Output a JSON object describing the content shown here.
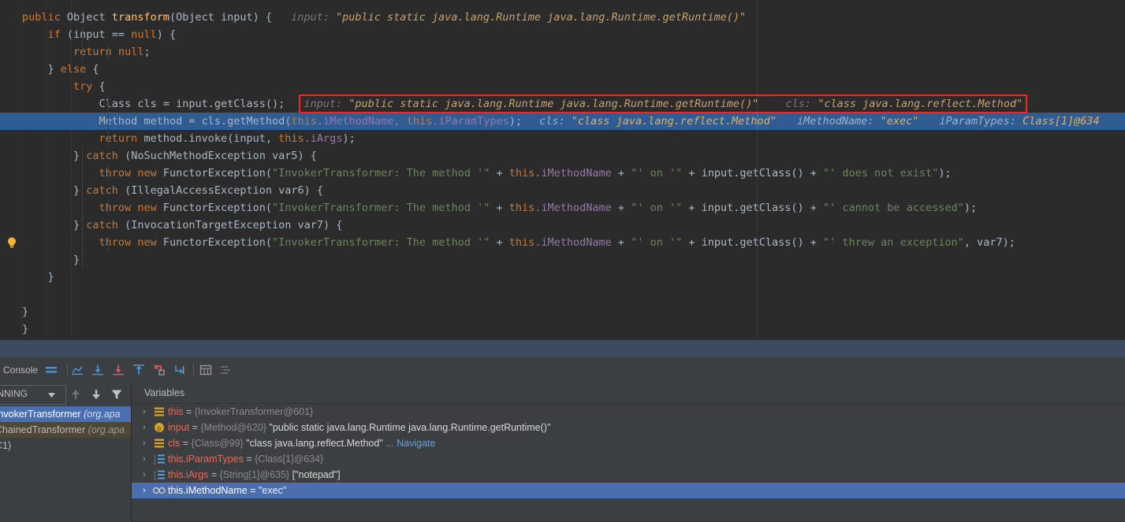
{
  "editor": {
    "code_lines": [
      {
        "indent": 0,
        "segments": [
          {
            "t": "public ",
            "c": "kw"
          },
          {
            "t": "Object ",
            "c": "id"
          },
          {
            "t": "transform",
            "c": "fn"
          },
          {
            "t": "(",
            "c": "id"
          },
          {
            "t": "Object ",
            "c": "id"
          },
          {
            "t": "input",
            "c": "id"
          },
          {
            "t": ") {",
            "c": "id"
          }
        ],
        "hints": [
          {
            "label": "input: ",
            "value": "\"public static java.lang.Runtime java.lang.Runtime.getRuntime()\"",
            "gap": 24
          }
        ]
      },
      {
        "indent": 1,
        "segments": [
          {
            "t": "if ",
            "c": "kw"
          },
          {
            "t": "(input == ",
            "c": "id"
          },
          {
            "t": "null",
            "c": "kw"
          },
          {
            "t": ") {",
            "c": "id"
          }
        ],
        "hints": []
      },
      {
        "indent": 2,
        "segments": [
          {
            "t": "return ",
            "c": "kw"
          },
          {
            "t": "null",
            "c": "kw"
          },
          {
            "t": ";",
            "c": "id"
          }
        ],
        "hints": []
      },
      {
        "indent": 1,
        "segments": [
          {
            "t": "} ",
            "c": "id"
          },
          {
            "t": "else",
            "c": "kw"
          },
          {
            "t": " {",
            "c": "id"
          }
        ],
        "hints": []
      },
      {
        "indent": 2,
        "segments": [
          {
            "t": "try",
            "c": "kw"
          },
          {
            "t": " {",
            "c": "id"
          }
        ],
        "hints": []
      },
      {
        "indent": 3,
        "segments": [
          {
            "t": "Class cls = input.getClass();",
            "c": "id"
          }
        ],
        "hints": [
          {
            "label": "input: ",
            "value": "\"public static java.lang.Runtime java.lang.Runtime.getRuntime()\"",
            "gap": 24
          },
          {
            "label": "cls: ",
            "value": "\"class java.lang.reflect.Method\"",
            "gap": 34
          }
        ]
      },
      {
        "indent": 3,
        "exec": true,
        "segments": [
          {
            "t": "Method method = cls.getMethod(",
            "c": "id"
          },
          {
            "t": "this",
            "c": "kw"
          },
          {
            "t": ".iMethodName, ",
            "c": "fld"
          },
          {
            "t": "this",
            "c": "kw"
          },
          {
            "t": ".iParamTypes",
            "c": "fld"
          },
          {
            "t": ");",
            "c": "id"
          }
        ],
        "hints": [
          {
            "label": "cls: ",
            "value": "\"class java.lang.reflect.Method\"",
            "gap": 22
          },
          {
            "label": "iMethodName: ",
            "value": "\"exec\"",
            "gap": 26
          },
          {
            "label": "iParamTypes: ",
            "value": "Class[1]@634",
            "gap": 26
          }
        ]
      },
      {
        "indent": 3,
        "segments": [
          {
            "t": "return ",
            "c": "kw"
          },
          {
            "t": "method.invoke(input, ",
            "c": "id"
          },
          {
            "t": "this",
            "c": "kw"
          },
          {
            "t": ".iArgs",
            "c": "fld"
          },
          {
            "t": ");",
            "c": "id"
          }
        ],
        "hints": []
      },
      {
        "indent": 2,
        "segments": [
          {
            "t": "} ",
            "c": "id"
          },
          {
            "t": "catch ",
            "c": "kw"
          },
          {
            "t": "(NoSuchMethodException var5) {",
            "c": "id"
          }
        ],
        "hints": []
      },
      {
        "indent": 3,
        "segments": [
          {
            "t": "throw new ",
            "c": "kw"
          },
          {
            "t": "FunctorException(",
            "c": "id"
          },
          {
            "t": "\"InvokerTransformer: The method '\"",
            "c": "str"
          },
          {
            "t": " + ",
            "c": "id"
          },
          {
            "t": "this",
            "c": "kw"
          },
          {
            "t": ".iMethodName",
            "c": "fld"
          },
          {
            "t": " + ",
            "c": "id"
          },
          {
            "t": "\"' on '\"",
            "c": "str"
          },
          {
            "t": " + input.getClass() + ",
            "c": "id"
          },
          {
            "t": "\"' does not exist\"",
            "c": "str"
          },
          {
            "t": ");",
            "c": "id"
          }
        ],
        "hints": []
      },
      {
        "indent": 2,
        "segments": [
          {
            "t": "} ",
            "c": "id"
          },
          {
            "t": "catch ",
            "c": "kw"
          },
          {
            "t": "(IllegalAccessException var6) {",
            "c": "id"
          }
        ],
        "hints": []
      },
      {
        "indent": 3,
        "segments": [
          {
            "t": "throw new ",
            "c": "kw"
          },
          {
            "t": "FunctorException(",
            "c": "id"
          },
          {
            "t": "\"InvokerTransformer: The method '\"",
            "c": "str"
          },
          {
            "t": " + ",
            "c": "id"
          },
          {
            "t": "this",
            "c": "kw"
          },
          {
            "t": ".iMethodName",
            "c": "fld"
          },
          {
            "t": " + ",
            "c": "id"
          },
          {
            "t": "\"' on '\"",
            "c": "str"
          },
          {
            "t": " + input.getClass() + ",
            "c": "id"
          },
          {
            "t": "\"' cannot be accessed\"",
            "c": "str"
          },
          {
            "t": ");",
            "c": "id"
          }
        ],
        "hints": []
      },
      {
        "indent": 2,
        "segments": [
          {
            "t": "} ",
            "c": "id"
          },
          {
            "t": "catch ",
            "c": "kw"
          },
          {
            "t": "(InvocationTargetException var7) {",
            "c": "id"
          }
        ],
        "hints": []
      },
      {
        "indent": 3,
        "bulb": true,
        "segments": [
          {
            "t": "throw new ",
            "c": "kw"
          },
          {
            "t": "FunctorException(",
            "c": "id"
          },
          {
            "t": "\"InvokerTransformer: The method '\"",
            "c": "str"
          },
          {
            "t": " + ",
            "c": "id"
          },
          {
            "t": "this",
            "c": "kw"
          },
          {
            "t": ".iMethodName",
            "c": "fld"
          },
          {
            "t": " + ",
            "c": "id"
          },
          {
            "t": "\"' on '\"",
            "c": "str"
          },
          {
            "t": " + input.getClass() + ",
            "c": "id"
          },
          {
            "t": "\"' threw an exception\"",
            "c": "str"
          },
          {
            "t": ", var7);",
            "c": "id"
          }
        ],
        "hints": []
      },
      {
        "indent": 2,
        "segments": [
          {
            "t": "}",
            "c": "id"
          }
        ],
        "hints": []
      },
      {
        "indent": 1,
        "segments": [
          {
            "t": "}",
            "c": "id"
          }
        ],
        "hints": []
      },
      {
        "indent": 1,
        "segments": [],
        "hints": []
      },
      {
        "indent": 0,
        "segments": [
          {
            "t": "}",
            "c": "id"
          }
        ],
        "hints": []
      },
      {
        "indent": -1,
        "segments": [
          {
            "t": "}",
            "c": "id"
          }
        ],
        "hints": []
      }
    ],
    "annotation": {
      "name": "red-highlight-box",
      "color": "#ff2020"
    },
    "bulb_icon": "intention-bulb-icon"
  },
  "bottom_panel": {
    "tab_label": "Console",
    "toolbar_icons": [
      "soft-wrap-icon",
      "show-execution-point-icon",
      "step-over-icon",
      "step-into-icon",
      "force-step-into-icon",
      "step-out-icon",
      "drop-frame-icon",
      "run-to-cursor-icon",
      "evaluate-expression-icon",
      "mute-breakpoints-icon"
    ],
    "frames": {
      "thread_status": "RUNNING",
      "toolbar_icons": [
        "arrow-up-icon",
        "arrow-down-icon",
        "filter-icon"
      ],
      "items": [
        {
          "name": "InvokerTransformer",
          "pkg": "(org.apa",
          "state": "selected"
        },
        {
          "name": "ChainedTransformer",
          "pkg": "(org.apa",
          "state": "highlighted"
        },
        {
          "name": "C1)",
          "pkg": "",
          "state": "normal"
        }
      ]
    },
    "variables": {
      "header": "Variables",
      "rows": [
        {
          "icon": "field-icon",
          "arrow": "›",
          "name": "this",
          "eq": " = ",
          "ref": "{InvokerTransformer@601}",
          "value": "",
          "nav": "",
          "selected": false
        },
        {
          "icon": "parameter-icon",
          "arrow": "›",
          "name": "input",
          "eq": " = ",
          "ref": "{Method@620} ",
          "value": "\"public static java.lang.Runtime java.lang.Runtime.getRuntime()\"",
          "nav": "",
          "selected": false
        },
        {
          "icon": "field-icon",
          "arrow": "›",
          "name": "cls",
          "eq": " = ",
          "ref": "{Class@99} ",
          "value": "\"class java.lang.reflect.Method\"",
          "nav": "... Navigate",
          "selected": false
        },
        {
          "icon": "array-icon",
          "arrow": "›",
          "name": "this.iParamTypes",
          "eq": " = ",
          "ref": "{Class[1]@634}",
          "value": "",
          "nav": "",
          "selected": false
        },
        {
          "icon": "array-icon",
          "arrow": "›",
          "name": "this.iArgs",
          "eq": " = ",
          "ref": "{String[1]@635} ",
          "value": "[\"notepad\"]",
          "nav": "",
          "selected": false
        },
        {
          "icon": "string-icon",
          "arrow": "›",
          "name": "this.iMethodName",
          "eq": " = ",
          "ref": "",
          "value": "\"exec\"",
          "nav": "",
          "selected": true
        }
      ]
    }
  },
  "colors": {
    "editor_bg": "#2b2b2b",
    "panel_bg": "#3c3f41",
    "selection": "#4b6eaf",
    "exec_line": "#2f5c93",
    "annotation": "#ff2020",
    "keyword": "#cc7832",
    "string": "#6a8759",
    "field": "#9876aa",
    "method": "#ffc66d"
  }
}
